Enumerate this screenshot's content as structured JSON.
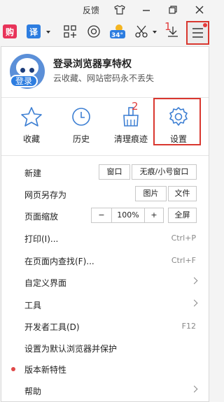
{
  "titlebar": {
    "feedback": "反馈"
  },
  "toolbar": {
    "buy_label": "购",
    "translate_label": "译",
    "weather_temp": "34°",
    "annotation_1": "1",
    "annotation_2": "2"
  },
  "account": {
    "login_tag": "登录",
    "title": "登录浏览器享特权",
    "subtitle": "云收藏、网站密码永不丢失"
  },
  "quick_actions": {
    "favorites": "收藏",
    "history": "历史",
    "clean": "清理痕迹",
    "settings": "设置"
  },
  "menu": {
    "new": "新建",
    "new_window": "窗口",
    "new_incognito": "无痕/小号窗口",
    "save_as": "网页另存为",
    "save_image": "图片",
    "save_file": "文件",
    "zoom": "页面缩放",
    "zoom_minus": "−",
    "zoom_value": "100%",
    "zoom_plus": "+",
    "fullscreen": "全屏",
    "print": "打印(I)...",
    "print_shortcut": "Ctrl+P",
    "find": "在页面内查找(F)...",
    "find_shortcut": "Ctrl+F",
    "customize": "自定义界面",
    "tools": "工具",
    "devtools": "开发者工具(D)",
    "devtools_shortcut": "F12",
    "default_browser": "设置为默认浏览器并保护",
    "whats_new": "版本新特性",
    "help": "帮助"
  },
  "colors": {
    "accent_red": "#d9372f",
    "brand_blue": "#2d7de0",
    "icon_blue": "#3d7fd3"
  }
}
